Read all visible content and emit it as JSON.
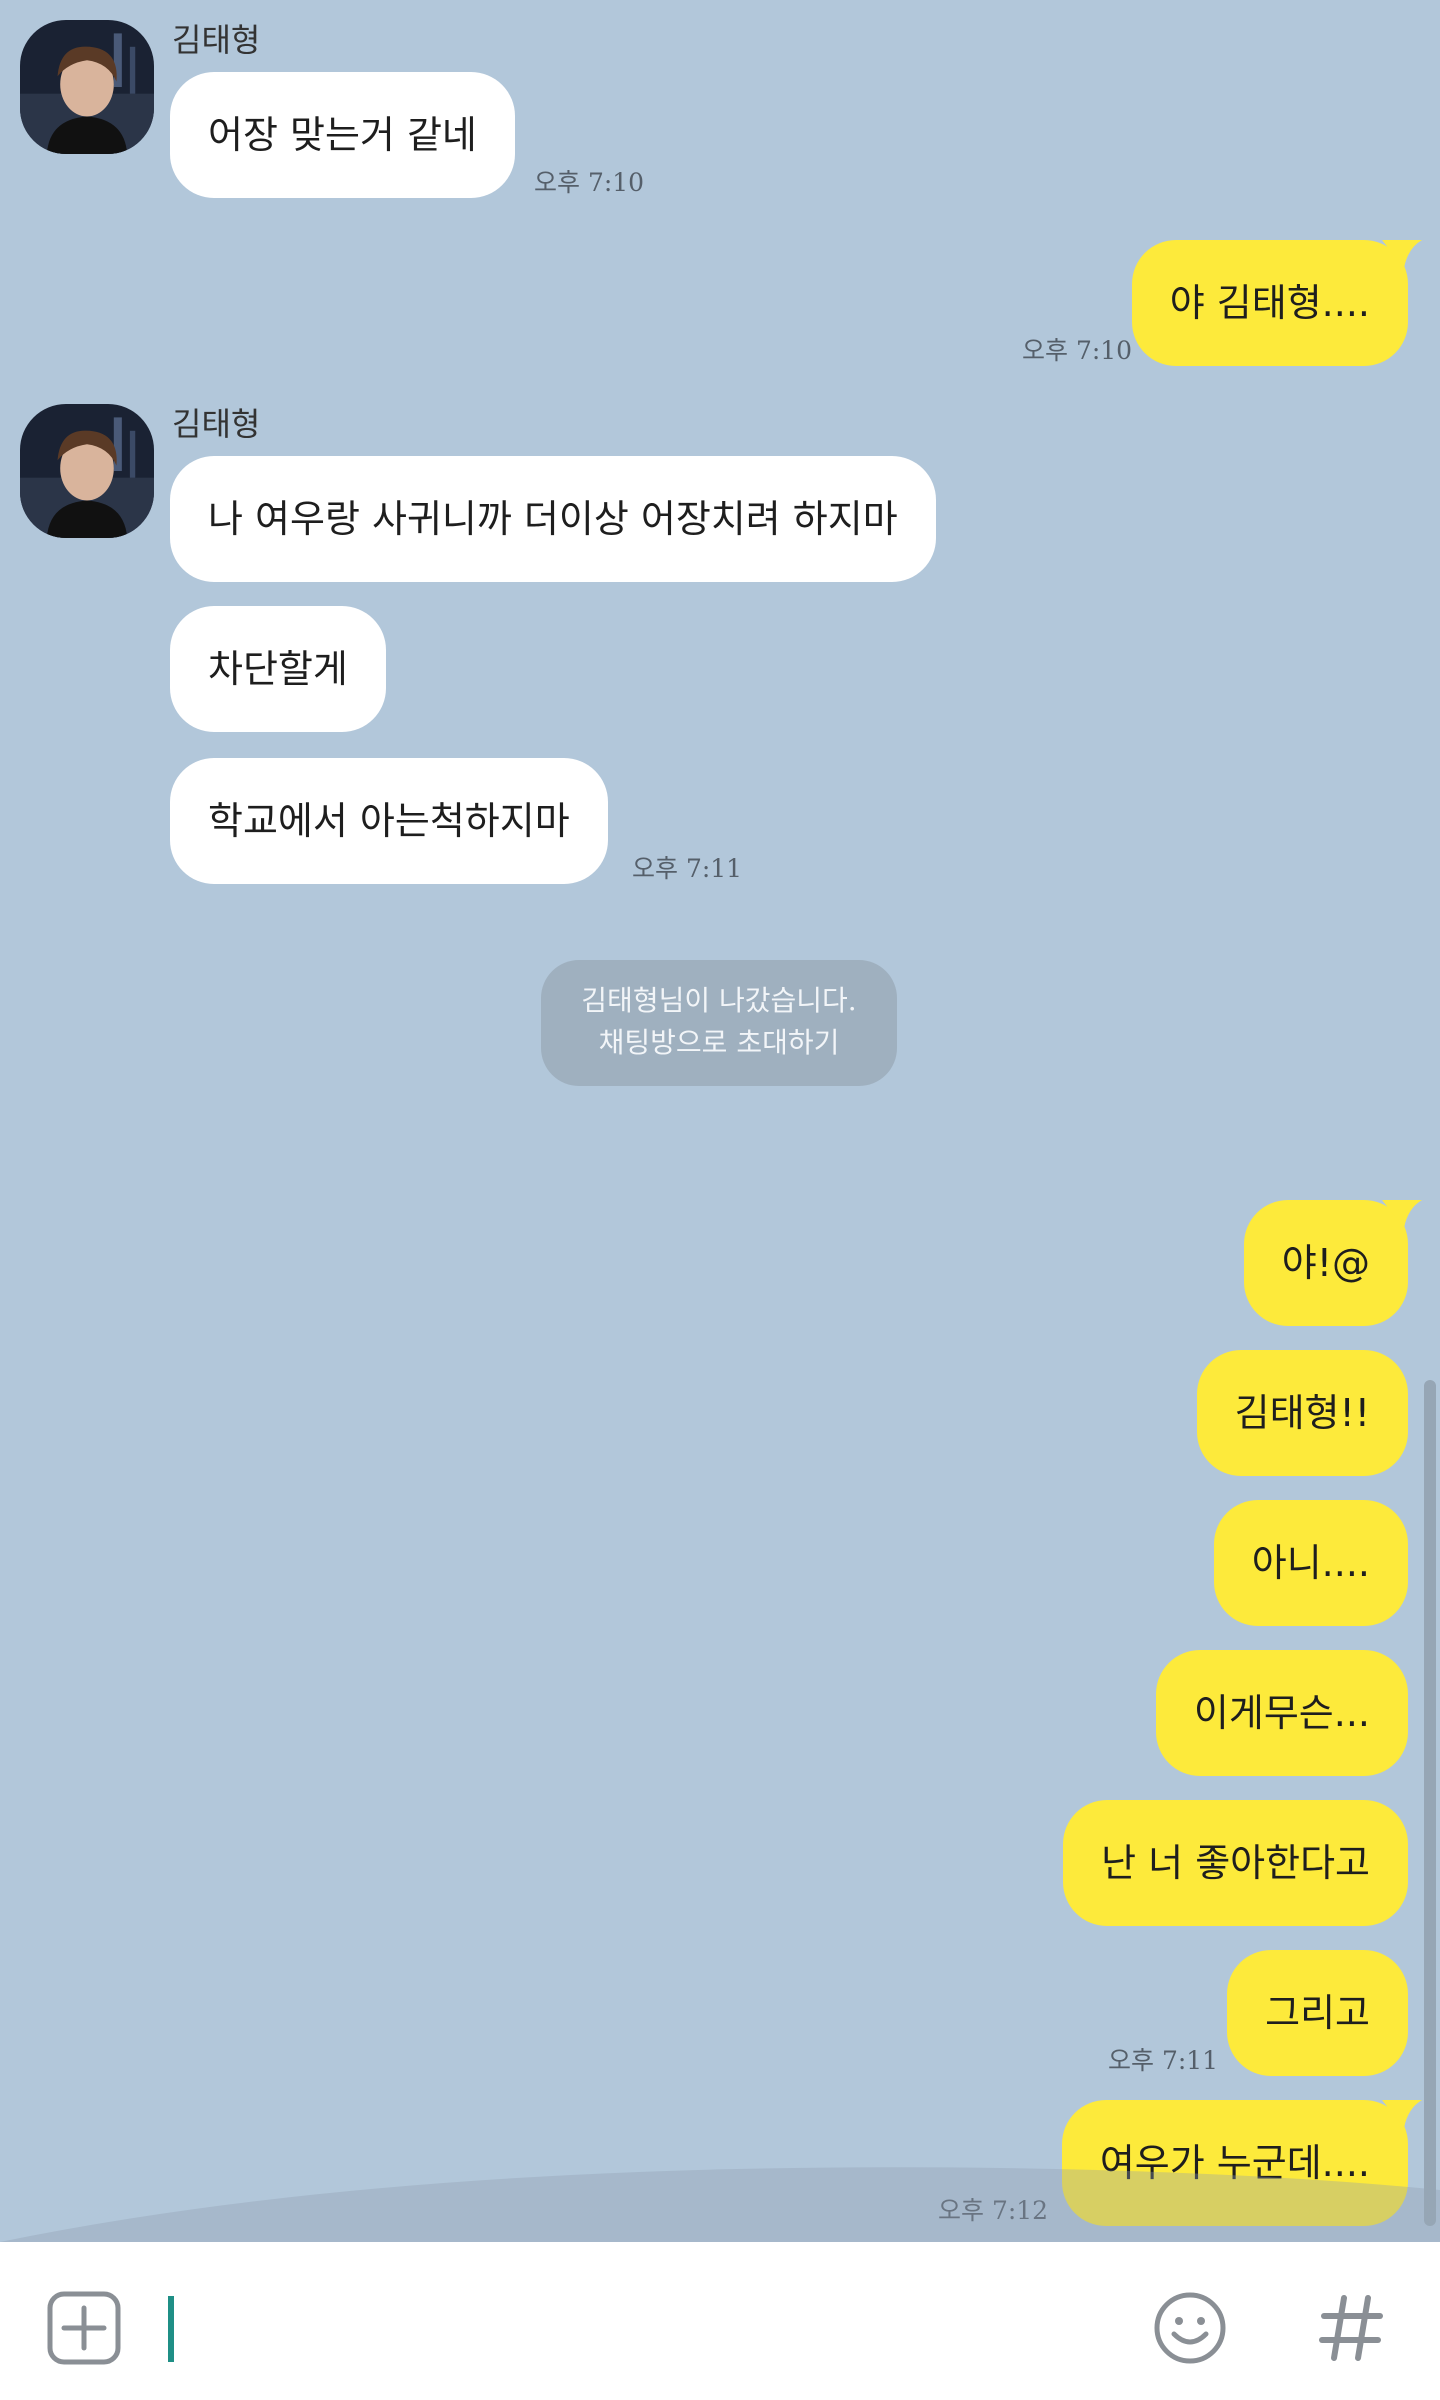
{
  "chat": {
    "groups": [
      {
        "sender": "김태형",
        "messages": [
          "어장 맞는거 같네"
        ],
        "time": "오후 7:10"
      },
      {
        "me": true,
        "messages": [
          "야 김태형...."
        ],
        "time": "오후 7:10"
      },
      {
        "sender": "김태형",
        "messages": [
          "나 여우랑 사귀니까 더이상 어장치려 하지마",
          "차단할게",
          "학교에서 아는척하지마"
        ],
        "time": "오후 7:11"
      },
      {
        "system": [
          "김태형님이 나갔습니다.",
          "채팅방으로 초대하기"
        ]
      },
      {
        "me": true,
        "messages": [
          "야!@",
          "김태형!!",
          "아니....",
          "이게무슨...",
          "난 너 좋아한다고",
          "그리고"
        ],
        "time": "오후 7:11"
      },
      {
        "me": true,
        "messages": [
          "여우가 누군데...."
        ],
        "time": "오후 7:12"
      }
    ]
  },
  "input": {
    "value": "",
    "add_icon": "plus-box-icon",
    "emoji_icon": "smiley-icon",
    "hash_icon": "hash-icon"
  },
  "colors": {
    "background": "#b2c7da",
    "incoming_bubble": "#ffffff",
    "outgoing_bubble": "#fdea3b",
    "system_notice": "#9fb0bf",
    "cursor": "#1f8f86"
  }
}
